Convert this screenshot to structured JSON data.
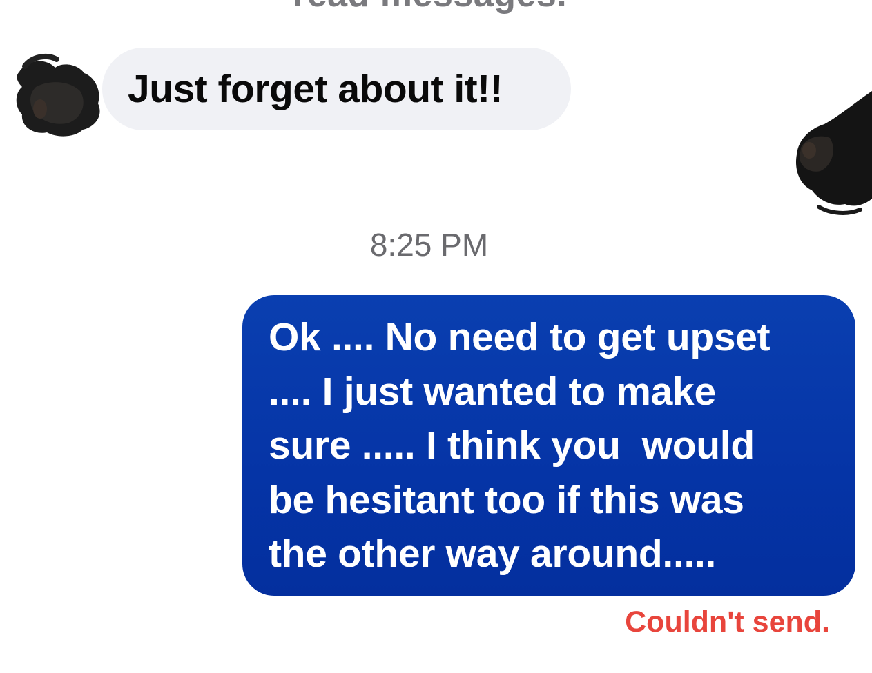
{
  "conversation": {
    "clipped_header_text": "read messages.",
    "incoming_message": {
      "text": "Just forget about it!!"
    },
    "timestamp": "8:25 PM",
    "outgoing_message": {
      "lines": [
        "Ok .... No need to get upset",
        ".... I just wanted to make",
        "sure ..... I think you  would",
        "be hesitant too if this was",
        "the other way around....."
      ],
      "status": "Couldn't send."
    }
  },
  "colors": {
    "incoming_bubble": "#f0f1f5",
    "outgoing_bubble": "#0534a6",
    "error_text": "#e8453c",
    "timestamp_text": "#6a6a6e"
  },
  "icons": {
    "sender_avatar": "redacted-avatar",
    "read_receipt_avatar": "redacted-avatar"
  }
}
